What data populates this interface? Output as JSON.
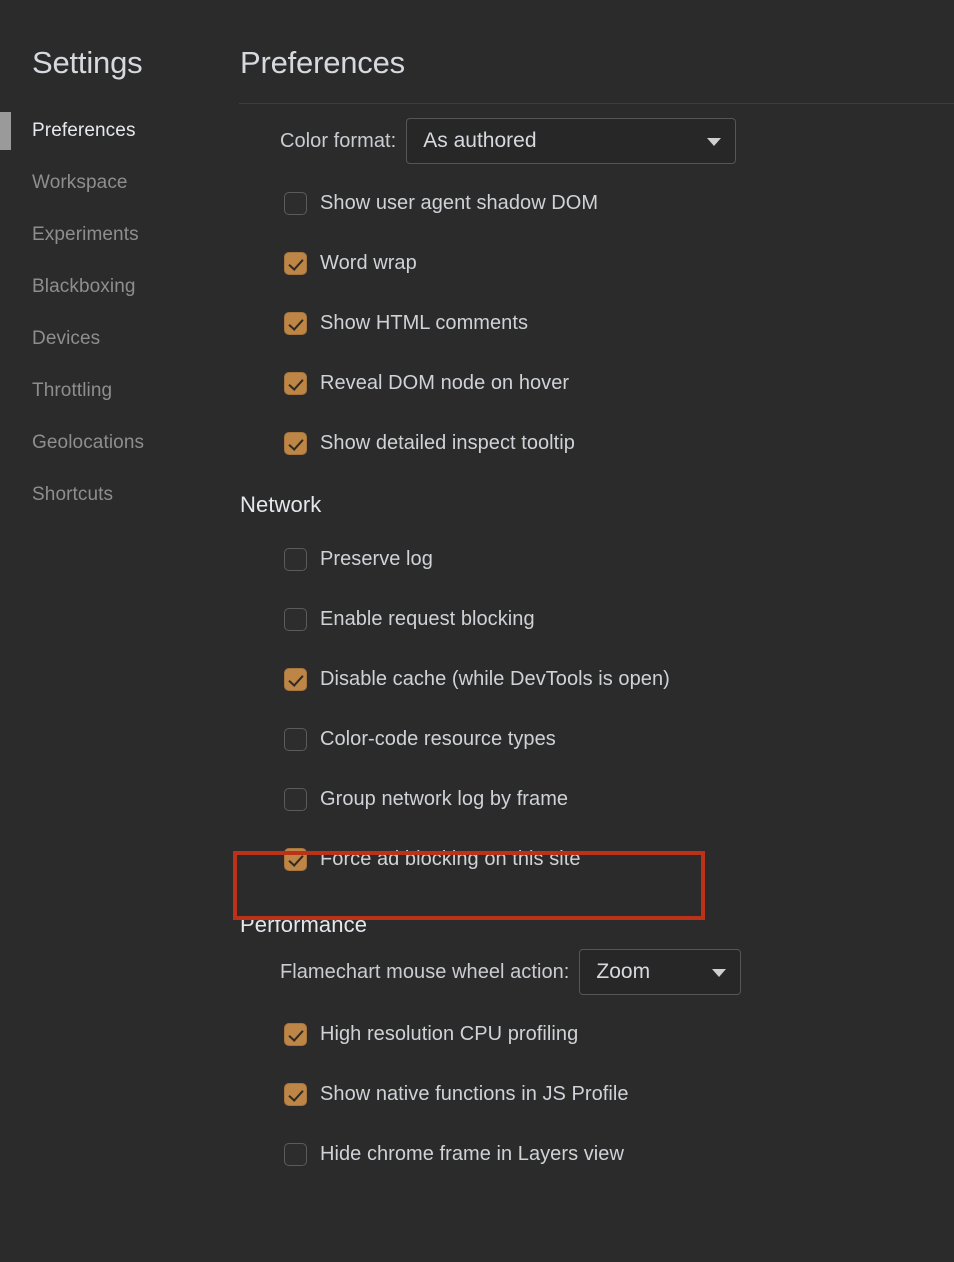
{
  "colors": {
    "background": "#2b2b2b",
    "text_primary": "#d6d9dd",
    "text_muted": "#8e8e8e",
    "checkbox_checked": "#bd8647",
    "annotation_red": "#bc3219",
    "selection_indicator": "#9a9a9a",
    "divider": "#3d3d3d"
  },
  "sidebar": {
    "title": "Settings",
    "items": [
      {
        "label": "Preferences",
        "selected": true
      },
      {
        "label": "Workspace",
        "selected": false
      },
      {
        "label": "Experiments",
        "selected": false
      },
      {
        "label": "Blackboxing",
        "selected": false
      },
      {
        "label": "Devices",
        "selected": false
      },
      {
        "label": "Throttling",
        "selected": false
      },
      {
        "label": "Geolocations",
        "selected": false
      },
      {
        "label": "Shortcuts",
        "selected": false
      }
    ]
  },
  "main": {
    "page_title": "Preferences",
    "elements_section": {
      "color_format": {
        "label": "Color format:",
        "value": "As authored",
        "caret_icon": "chevron-down-icon"
      },
      "checkboxes": [
        {
          "label": "Show user agent shadow DOM",
          "checked": false
        },
        {
          "label": "Word wrap",
          "checked": true
        },
        {
          "label": "Show HTML comments",
          "checked": true
        },
        {
          "label": "Reveal DOM node on hover",
          "checked": true
        },
        {
          "label": "Show detailed inspect tooltip",
          "checked": true
        }
      ]
    },
    "network_section": {
      "heading": "Network",
      "checkboxes": [
        {
          "label": "Preserve log",
          "checked": false
        },
        {
          "label": "Enable request blocking",
          "checked": false
        },
        {
          "label": "Disable cache (while DevTools is open)",
          "checked": true
        },
        {
          "label": "Color-code resource types",
          "checked": false
        },
        {
          "label": "Group network log by frame",
          "checked": false
        },
        {
          "label": "Force ad blocking on this site",
          "checked": true,
          "highlighted": true
        }
      ]
    },
    "performance_section": {
      "heading": "Performance",
      "flamechart_mouse_wheel": {
        "label": "Flamechart mouse wheel action:",
        "value": "Zoom",
        "caret_icon": "chevron-down-icon"
      },
      "checkboxes": [
        {
          "label": "High resolution CPU profiling",
          "checked": true
        },
        {
          "label": "Show native functions in JS Profile",
          "checked": true
        },
        {
          "label": "Hide chrome frame in Layers view",
          "checked": false
        }
      ]
    }
  }
}
